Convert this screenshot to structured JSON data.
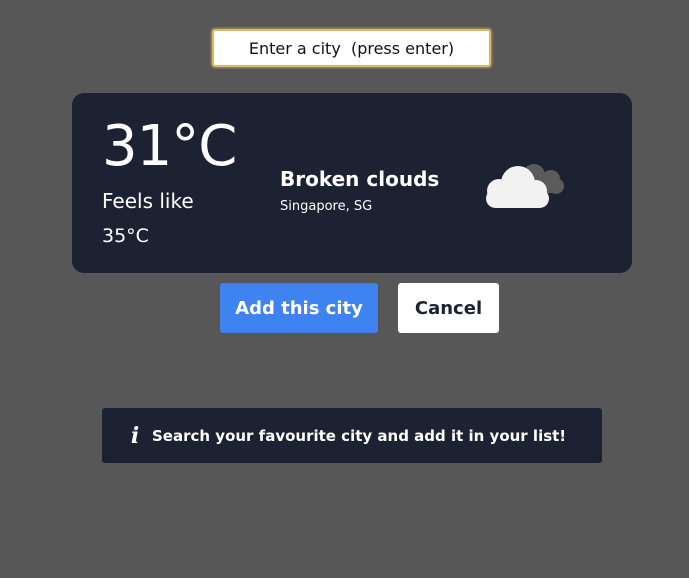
{
  "search": {
    "placeholder": "Enter a city  (press enter)",
    "value": ""
  },
  "weather": {
    "temperature": "31°C",
    "feels_like_label": "Feels like",
    "feels_like_value": "35°C",
    "condition": "Broken clouds",
    "location": "Singapore, SG",
    "icon": "broken-clouds-icon"
  },
  "actions": {
    "add_label": "Add this city",
    "cancel_label": "Cancel"
  },
  "info": {
    "icon": "info-icon",
    "glyph": "i",
    "message": "Search your favourite city and add it in your list!"
  },
  "colors": {
    "page_background": "#575757",
    "card_background": "#1c2231",
    "primary_button": "#3f83f0",
    "text_light": "#ffffff"
  }
}
